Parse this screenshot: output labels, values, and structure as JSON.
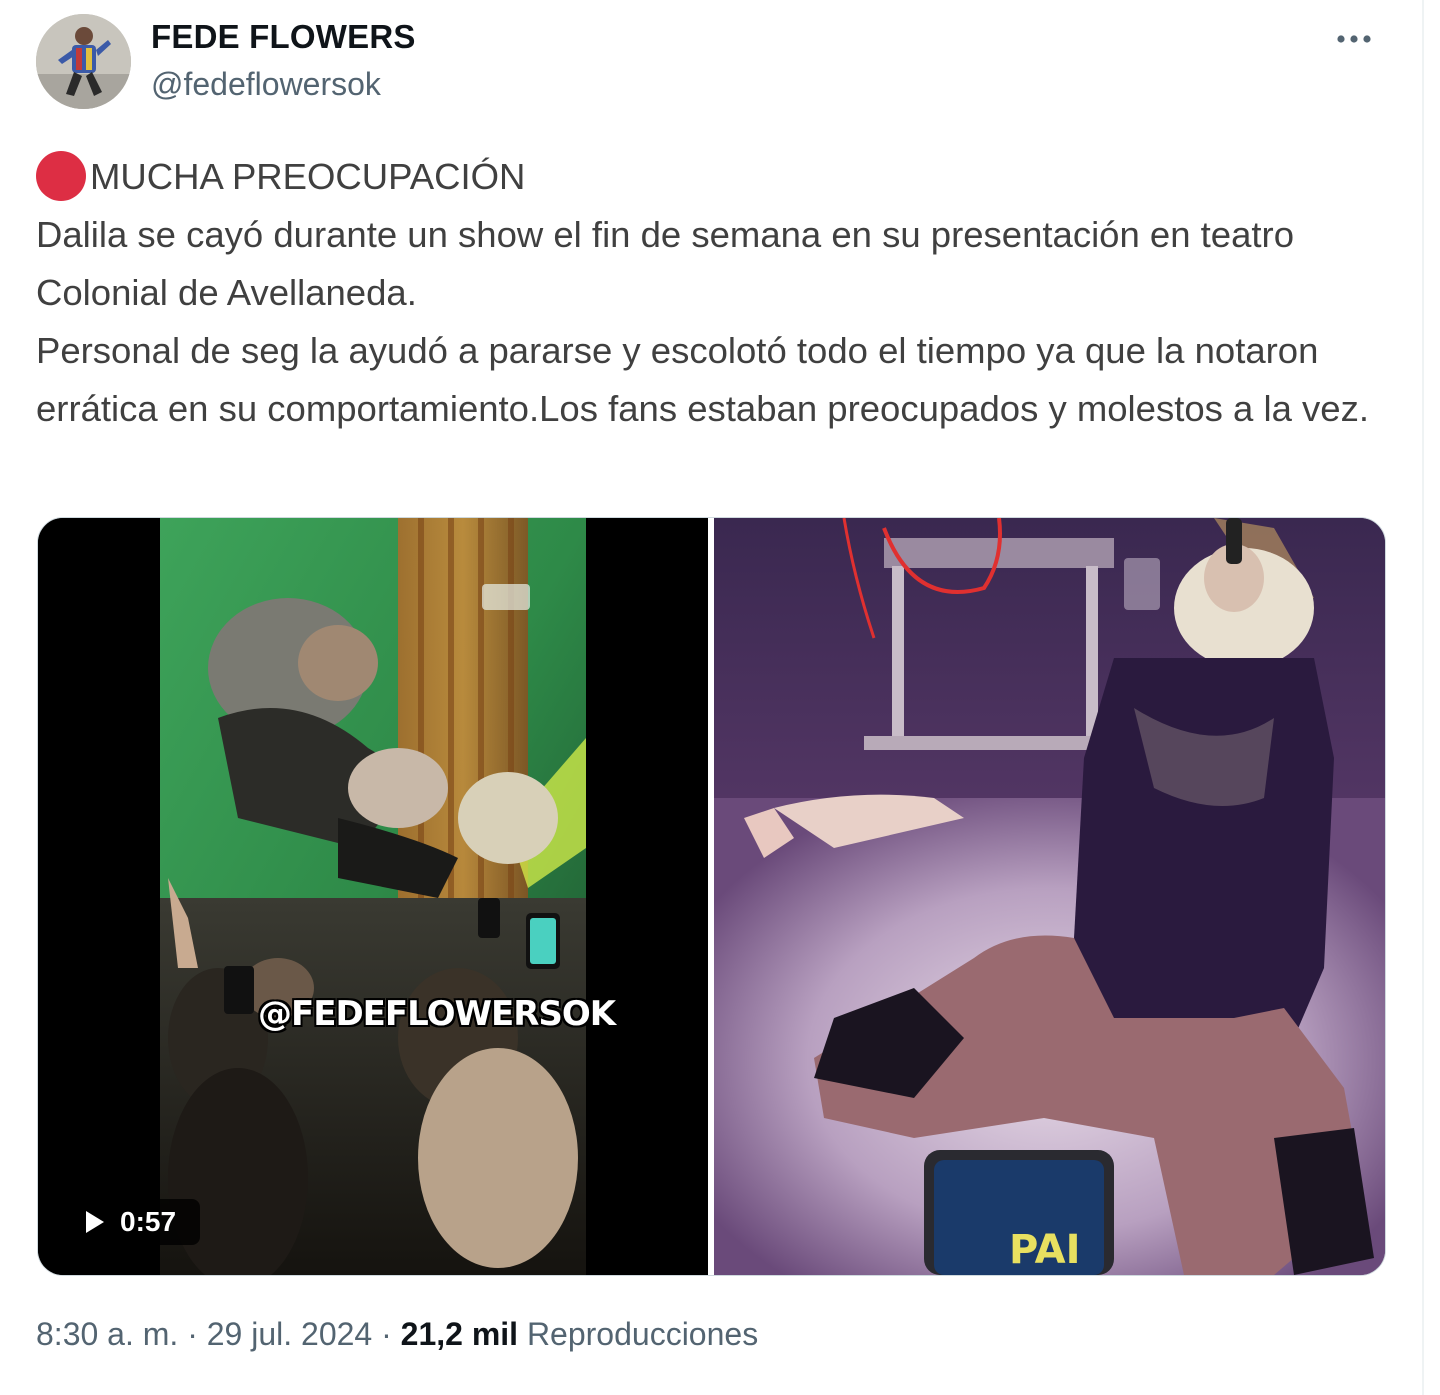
{
  "author": {
    "name": "FEDE FLOWERS",
    "handle": "@fedeflowersok",
    "avatar_icon": "profile-photo"
  },
  "more_icon": "ellipsis-icon",
  "tweet": {
    "headline": "MUCHA PREOCUPACIÓN",
    "headline_icon": "red-circle-emoji",
    "headline_icon_color": "#dd2e44",
    "line1": "Dalila se cayó durante un show el fin de semana en su presentación en teatro Colonial de Avellaneda.",
    "line2": "Personal de seg la ayudó a pararse y escolotó todo el tiempo ya que la notaron errática en su comportamiento.Los fans estaban preocupados y molestos a la vez."
  },
  "media": {
    "video": {
      "watermark": "@FEDEFLOWERSOK",
      "duration": "0:57",
      "play_icon": "play-icon"
    },
    "photo": {
      "phone_screen_text": "PAI"
    }
  },
  "meta": {
    "time": "8:30 a. m.",
    "sep1": " · ",
    "date": "29 jul. 2024",
    "sep2": " · ",
    "views_count": "21,2 mil",
    "views_label": "Reproducciones"
  },
  "colors": {
    "text_primary": "#0f1419",
    "text_secondary": "#536471",
    "border": "#cfd9de"
  }
}
